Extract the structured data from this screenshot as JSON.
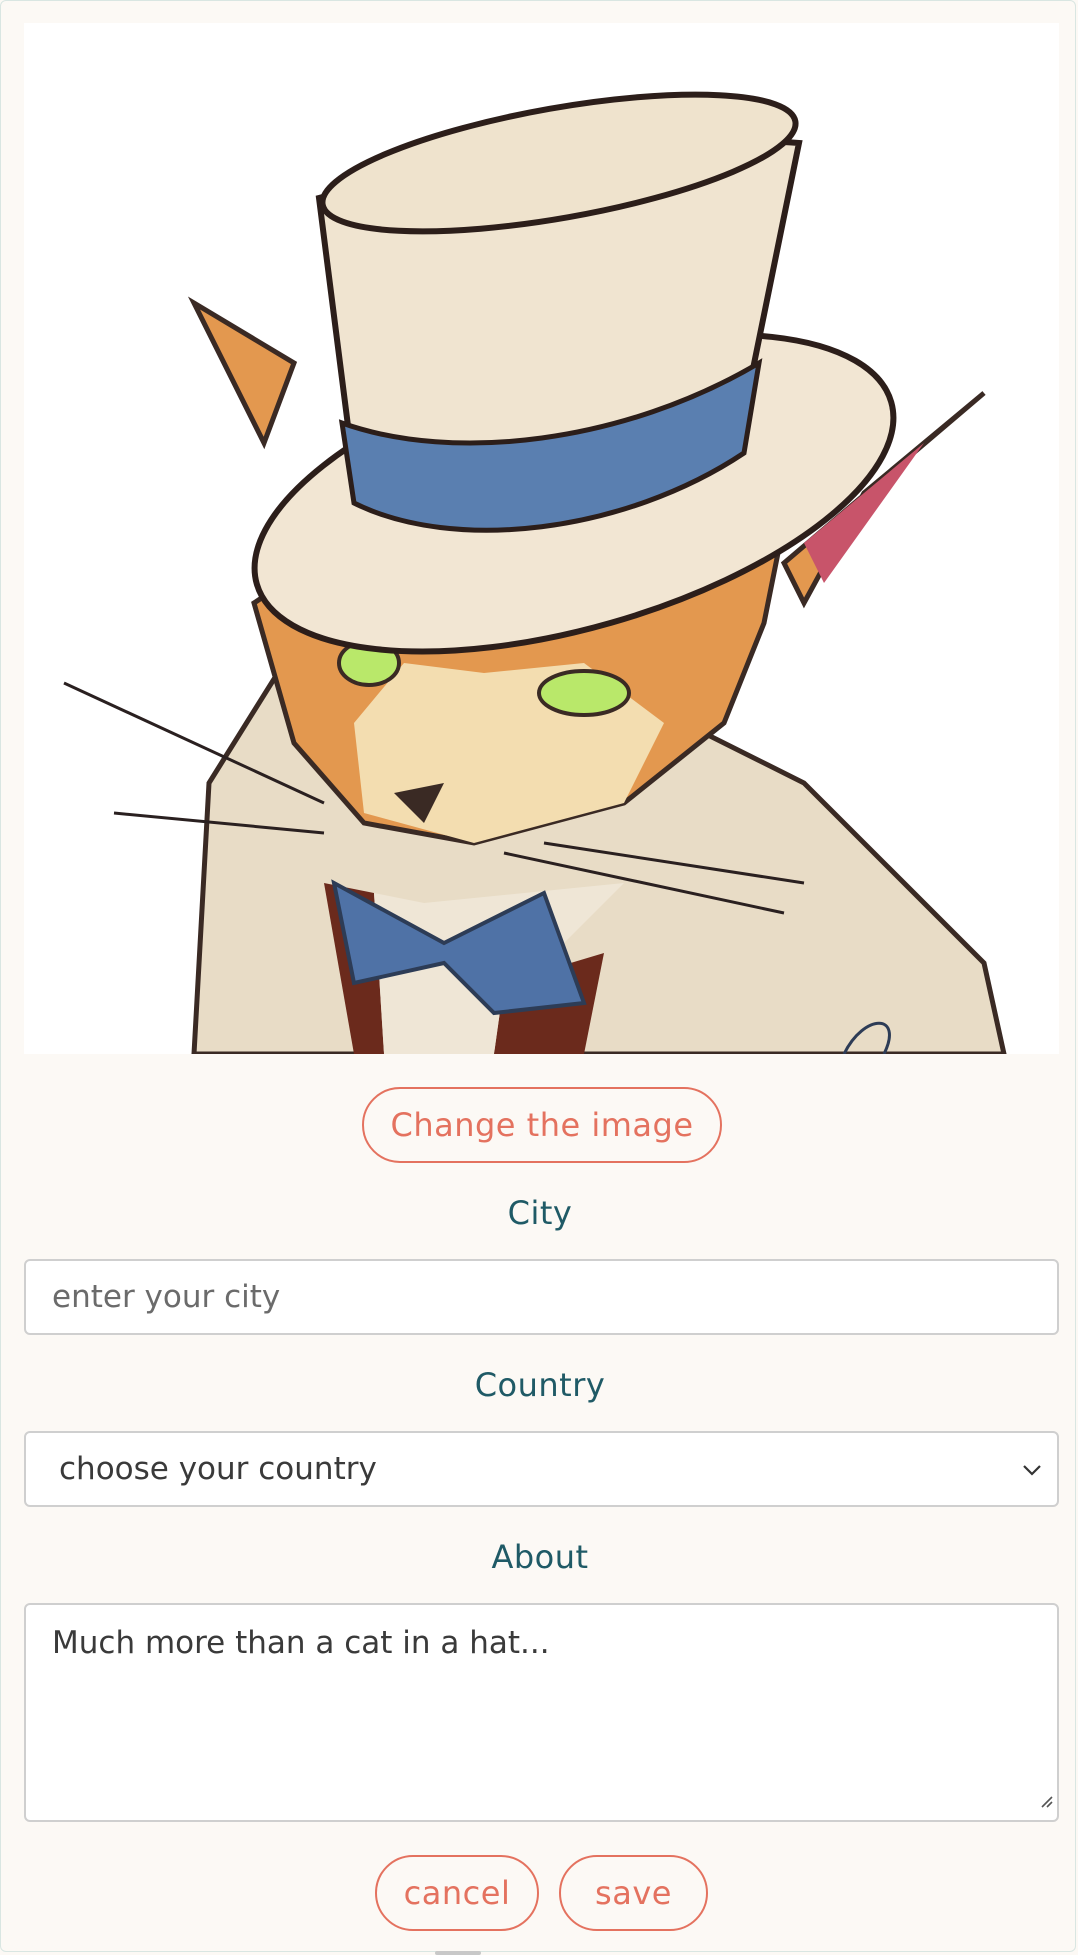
{
  "profile_image": {
    "alt_icon": "cat-in-top-hat-illustration"
  },
  "change_image_button": {
    "label": "Change the image"
  },
  "city": {
    "label": "City",
    "value": "",
    "placeholder": "enter your city"
  },
  "country": {
    "label": "Country",
    "selected": "choose your country",
    "icon": "chevron-down-icon"
  },
  "about": {
    "label": "About",
    "value": "Much more than a cat in a hat..."
  },
  "actions": {
    "cancel_label": "cancel",
    "save_label": "save"
  },
  "colors": {
    "accent": "#e4725f",
    "label": "#1f5a66",
    "background": "#fcf9f5",
    "hat_band": "#5a7fb0",
    "fur": "#e0954a"
  }
}
